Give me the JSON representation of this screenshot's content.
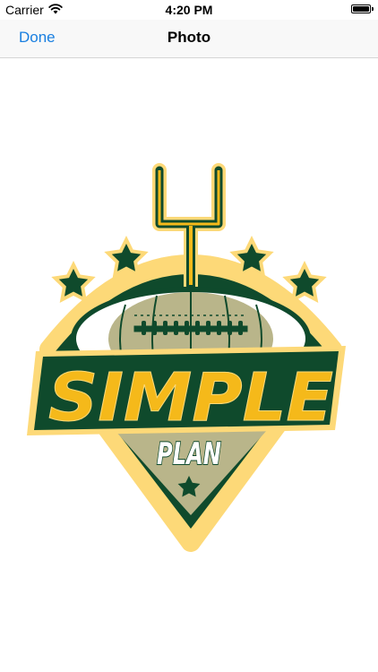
{
  "status_bar": {
    "carrier": "Carrier",
    "time": "4:20 PM",
    "wifi_icon": "wifi-icon",
    "battery_icon": "battery-icon"
  },
  "nav_bar": {
    "done_label": "Done",
    "title": "Photo"
  },
  "photo": {
    "logo_word": "SIMPLE",
    "logo_subword": "PLAN",
    "colors": {
      "dark_green": "#0f4a2c",
      "gold": "#f5b91a",
      "light_gold": "#fdd978",
      "khaki": "#b9b58a",
      "white": "#ffffff"
    }
  }
}
